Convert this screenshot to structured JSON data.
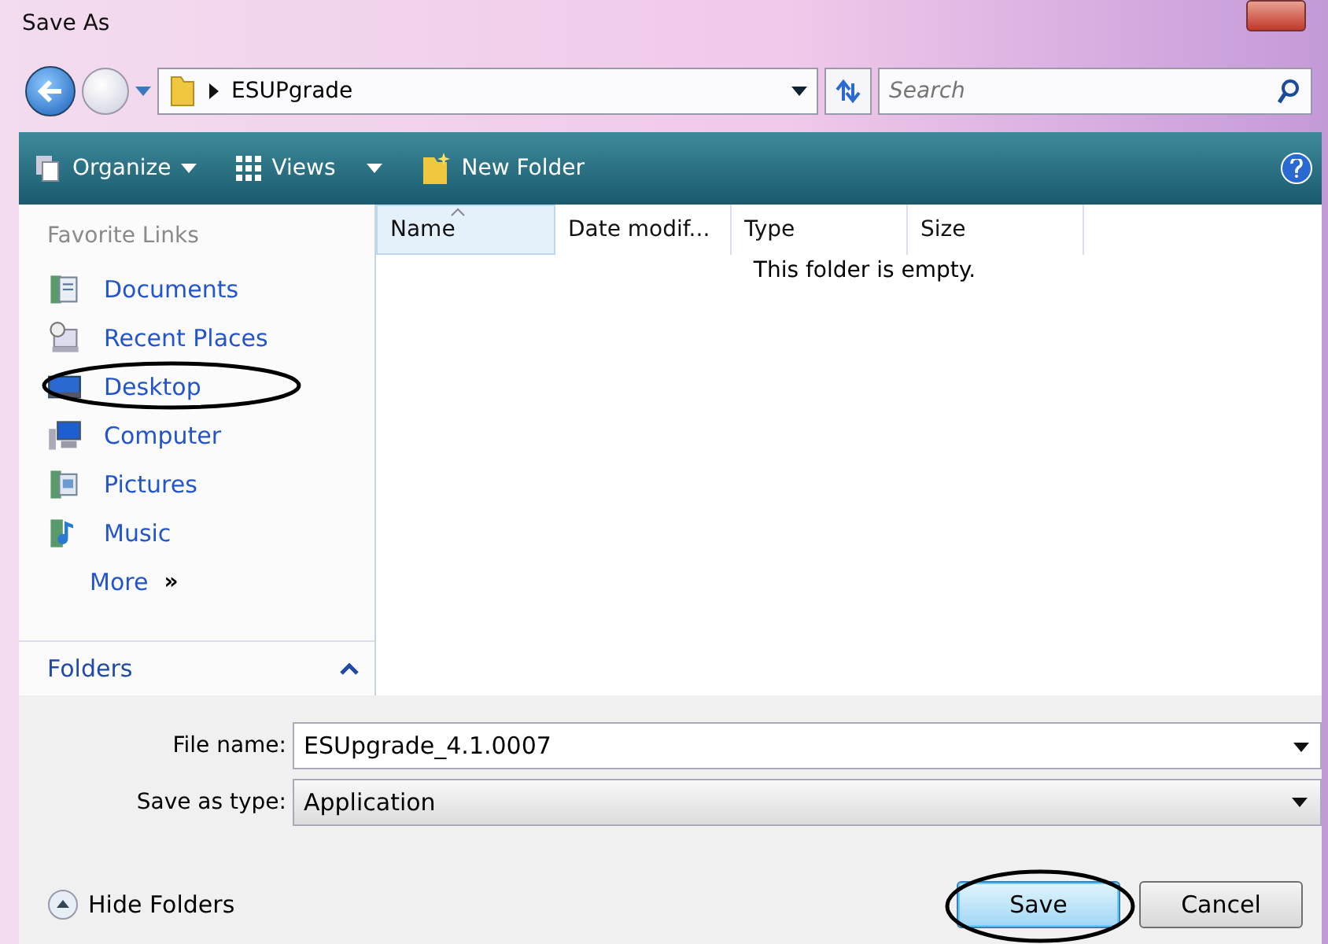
{
  "window": {
    "title": "Save As"
  },
  "address": {
    "path": "ESUPgrade"
  },
  "search": {
    "placeholder": "Search"
  },
  "toolbar": {
    "organize": "Organize",
    "views": "Views",
    "new_folder": "New Folder"
  },
  "sidebar": {
    "header": "Favorite Links",
    "items": [
      {
        "label": "Documents",
        "kind": "documents",
        "circled": false
      },
      {
        "label": "Recent Places",
        "kind": "recent",
        "circled": false
      },
      {
        "label": "Desktop",
        "kind": "desktop",
        "circled": true
      },
      {
        "label": "Computer",
        "kind": "computer",
        "circled": false
      },
      {
        "label": "Pictures",
        "kind": "pictures",
        "circled": false
      },
      {
        "label": "Music",
        "kind": "music",
        "circled": false
      }
    ],
    "more": "More",
    "more_arrow": "»",
    "folders": "Folders"
  },
  "file_list": {
    "columns": [
      {
        "label": "Name",
        "sorted": true
      },
      {
        "label": "Date modif...",
        "sorted": false
      },
      {
        "label": "Type",
        "sorted": false
      },
      {
        "label": "Size",
        "sorted": false
      }
    ],
    "empty_message": "This folder is empty."
  },
  "form": {
    "file_name_label": "File name:",
    "file_name": "ESUpgrade_4.1.0007",
    "type_label": "Save as type:",
    "type": "Application"
  },
  "hide_folders": "Hide Folders",
  "buttons": [
    {
      "label": "Save",
      "default": true,
      "circled": true
    },
    {
      "label": "Cancel",
      "default": false,
      "circled": false
    }
  ]
}
